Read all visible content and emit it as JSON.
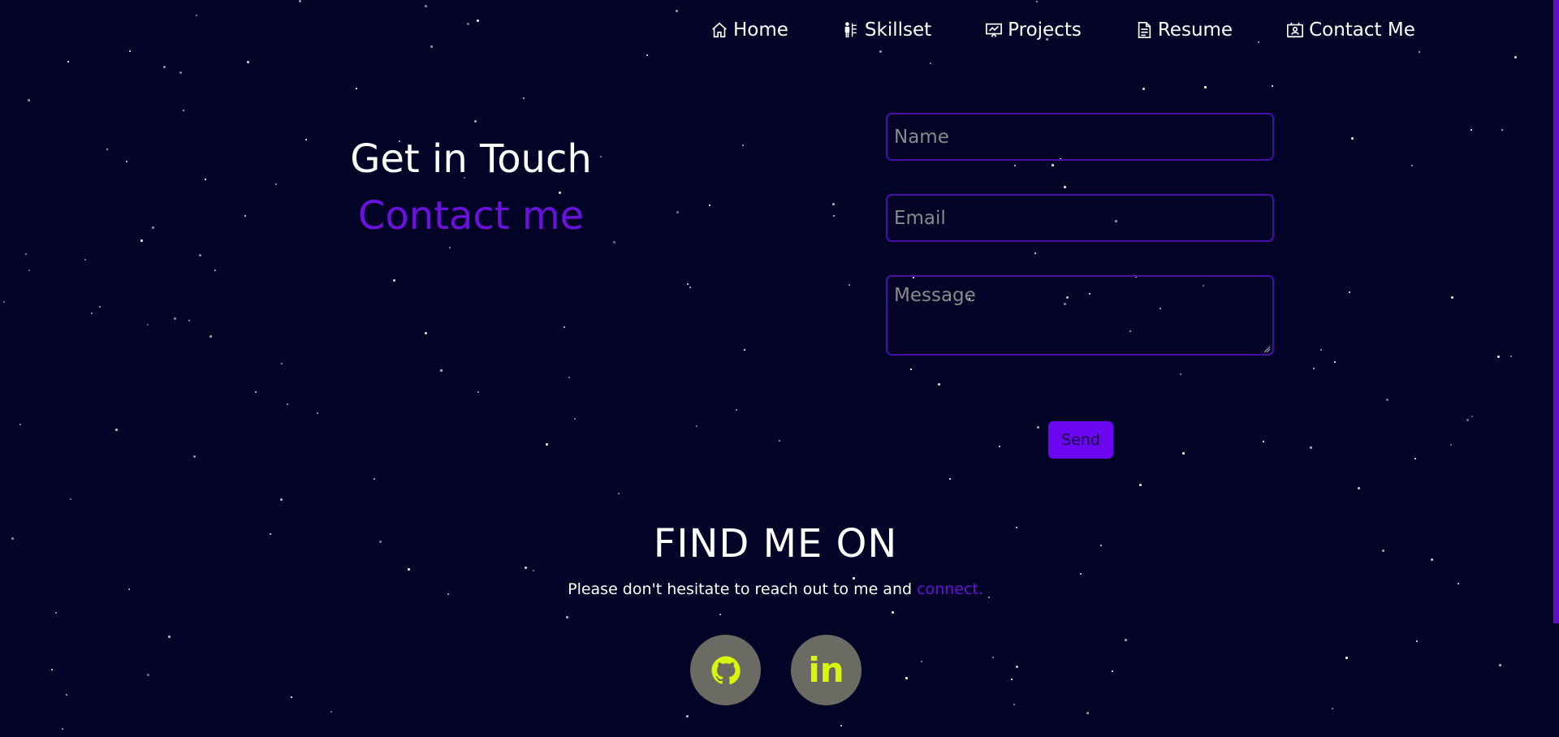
{
  "nav": {
    "items": [
      {
        "label": "Home",
        "icon": "home-icon"
      },
      {
        "label": "Skillset",
        "icon": "skillset-icon"
      },
      {
        "label": "Projects",
        "icon": "projects-icon"
      },
      {
        "label": "Resume",
        "icon": "resume-icon"
      },
      {
        "label": "Contact Me",
        "icon": "contact-icon"
      }
    ]
  },
  "hero": {
    "title": "Get in Touch",
    "subtitle": "Contact me"
  },
  "form": {
    "name_placeholder": "Name",
    "email_placeholder": "Email",
    "message_placeholder": "Message",
    "send_label": "Send"
  },
  "find": {
    "title": "FIND ME ON",
    "text": "Please don't hesitate to reach out to me and ",
    "link": "connect."
  },
  "social": {
    "github_icon": "github-icon",
    "linkedin_label": "in",
    "linkedin_icon": "linkedin-icon"
  },
  "colors": {
    "background": "#030328",
    "accent": "#6a12dc",
    "button": "#6a06f2",
    "social_bg": "#6b6b63",
    "social_fg": "#d9f50c"
  }
}
